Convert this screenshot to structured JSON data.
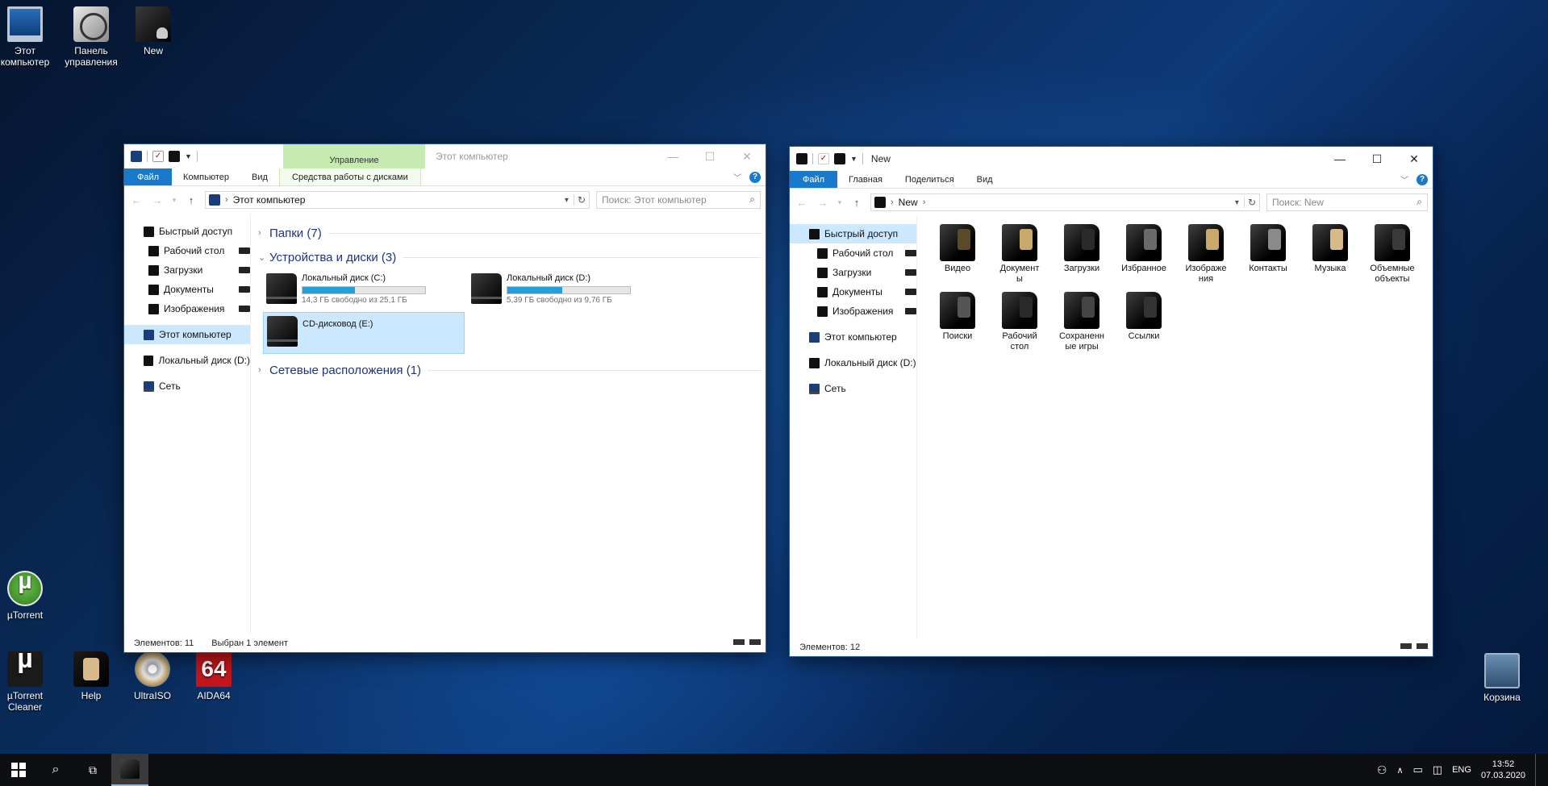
{
  "desktop": {
    "icons": [
      {
        "label": "Этот\nкомпьютер",
        "icon": "this-pc-icon"
      },
      {
        "label": "Панель\nуправления",
        "icon": "control-panel-icon"
      },
      {
        "label": "New",
        "icon": "user-folder-icon"
      },
      {
        "label": "µTorrent",
        "icon": "utorrent-icon"
      },
      {
        "label": "µTorrent\nCleaner",
        "icon": "utorrent-cleaner-icon"
      },
      {
        "label": "Help",
        "icon": "help-icon"
      },
      {
        "label": "UltraISO",
        "icon": "ultraiso-icon"
      },
      {
        "label": "AIDA64",
        "icon": "aida64-icon"
      },
      {
        "label": "Корзина",
        "icon": "recycle-bin-icon"
      }
    ],
    "aida_badge": "64"
  },
  "window_pc": {
    "title": "Этот компьютер",
    "context_tab": "Управление",
    "ribbon_tabs": [
      "Файл",
      "Компьютер",
      "Вид",
      "Средства работы с дисками"
    ],
    "address": "Этот компьютер",
    "search_placeholder": "Поиск: Этот компьютер",
    "nav": [
      "Быстрый доступ",
      "Рабочий стол",
      "Загрузки",
      "Документы",
      "Изображения",
      "Этот компьютер",
      "Локальный диск (D:)",
      "Сеть"
    ],
    "groups": [
      "Папки (7)",
      "Устройства и диски (3)",
      "Сетевые расположения (1)"
    ],
    "drives": [
      {
        "name": "Локальный диск (C:)",
        "free": "14,3 ГБ свободно из 25,1 ГБ",
        "used_fraction": 0.43
      },
      {
        "name": "Локальный диск (D:)",
        "free": "5,39 ГБ свободно из 9,76 ГБ",
        "used_fraction": 0.45
      },
      {
        "name": "CD-дисковод (E:)",
        "free": "",
        "used_fraction": 0
      }
    ],
    "status_count": "Элементов: 11",
    "status_selected": "Выбран 1 элемент"
  },
  "window_new": {
    "title": "New",
    "ribbon_tabs": [
      "Файл",
      "Главная",
      "Поделиться",
      "Вид"
    ],
    "address": "New",
    "search_placeholder": "Поиск: New",
    "nav": [
      "Быстрый доступ",
      "Рабочий стол",
      "Загрузки",
      "Документы",
      "Изображения",
      "Этот компьютер",
      "Локальный диск (D:)",
      "Сеть"
    ],
    "folders": [
      {
        "label": "Видео",
        "accent": "#5a4a2a"
      },
      {
        "label": "Документ\nы",
        "accent": "#c9a86c"
      },
      {
        "label": "Загрузки",
        "accent": "#2a2a2a"
      },
      {
        "label": "Избранное",
        "accent": "#6a6a6a"
      },
      {
        "label": "Изображе\nния",
        "accent": "#c9a86c"
      },
      {
        "label": "Контакты",
        "accent": "#8a8a8a"
      },
      {
        "label": "Музыка",
        "accent": "#d8b98a"
      },
      {
        "label": "Объемные\nобъекты",
        "accent": "#3a3a3a"
      },
      {
        "label": "Поиски",
        "accent": "#555555"
      },
      {
        "label": "Рабочий\nстол",
        "accent": "#2a2a2a"
      },
      {
        "label": "Сохраненн\nые игры",
        "accent": "#444444"
      },
      {
        "label": "Ссылки",
        "accent": "#333333"
      }
    ],
    "status_count": "Элементов: 12"
  },
  "taskbar": {
    "lang": "ENG",
    "time": "13:52",
    "date": "07.03.2020"
  },
  "colors": {
    "file_tab": "#1979ca",
    "selection": "#cce8ff",
    "drive_fill": "#26a0da",
    "manage_tab": "#c6eab0"
  }
}
